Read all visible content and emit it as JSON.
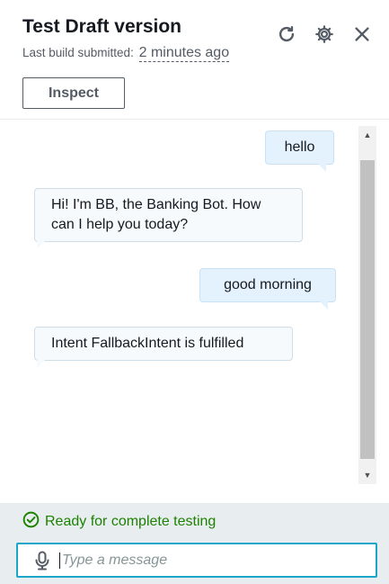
{
  "header": {
    "title": "Test Draft version",
    "build_label": "Last build submitted:",
    "build_time": "2 minutes ago",
    "inspect_label": "Inspect",
    "icons": [
      "refresh-icon",
      "gear-icon",
      "close-icon"
    ]
  },
  "messages": [
    {
      "from": "user",
      "lines": [
        "hello"
      ]
    },
    {
      "from": "bot",
      "lines": [
        "Hi! I'm BB, the Banking Bot. How",
        "can I help you today?"
      ]
    },
    {
      "from": "user",
      "lines": [
        "good morning"
      ]
    },
    {
      "from": "bot",
      "lines": [
        "Intent FallbackIntent is fulfilled"
      ]
    }
  ],
  "footer": {
    "status_text": "Ready for complete testing",
    "input_placeholder": "Type a message",
    "input_value": ""
  },
  "colors": {
    "status_green": "#1d8102",
    "input_focus": "#1aa6c9",
    "user_bubble": "#e3f2fd"
  }
}
